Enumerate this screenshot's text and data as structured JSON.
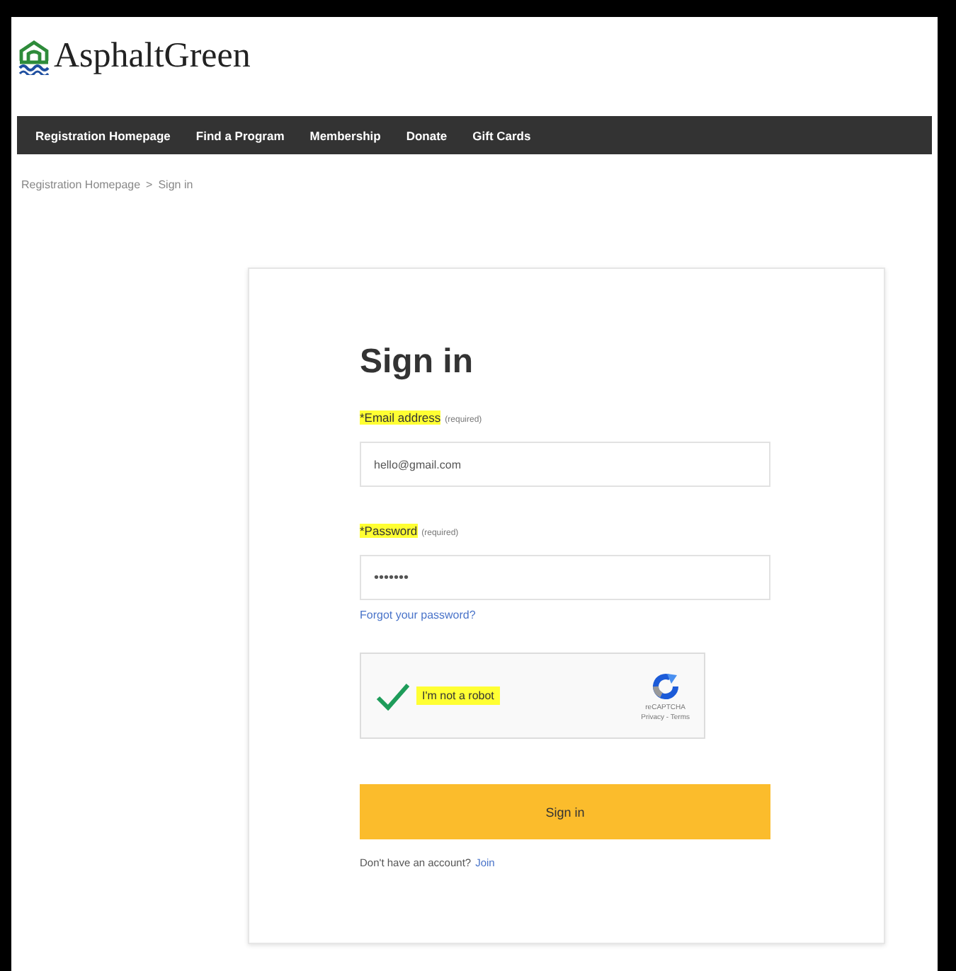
{
  "logo": {
    "text": "AsphaltGreen"
  },
  "nav": [
    {
      "label": "Registration Homepage"
    },
    {
      "label": "Find a Program"
    },
    {
      "label": "Membership"
    },
    {
      "label": "Donate"
    },
    {
      "label": "Gift Cards"
    }
  ],
  "breadcrumb": [
    {
      "label": "Registration Homepage"
    },
    {
      "label": "Sign in"
    }
  ],
  "breadcrumb_separator": ">",
  "form": {
    "title": "Sign in",
    "fields": [
      {
        "label": "Email address",
        "note": "(required)",
        "required_mark": "*",
        "highlighted": true,
        "value": "hello@gmail.com"
      },
      {
        "label": "Password",
        "note": "(required)",
        "required_mark": "*",
        "highlighted": true,
        "value": "•••••••"
      }
    ],
    "forgot_link": "Forgot your password?",
    "captcha": {
      "label": "I'm not a robot",
      "checked": true,
      "highlighted": true,
      "brand": "reCAPTCHA",
      "links": "Privacy - Terms"
    },
    "submit": "Sign in",
    "signup_text": "Don't have an account?",
    "signup_link": "Join"
  }
}
